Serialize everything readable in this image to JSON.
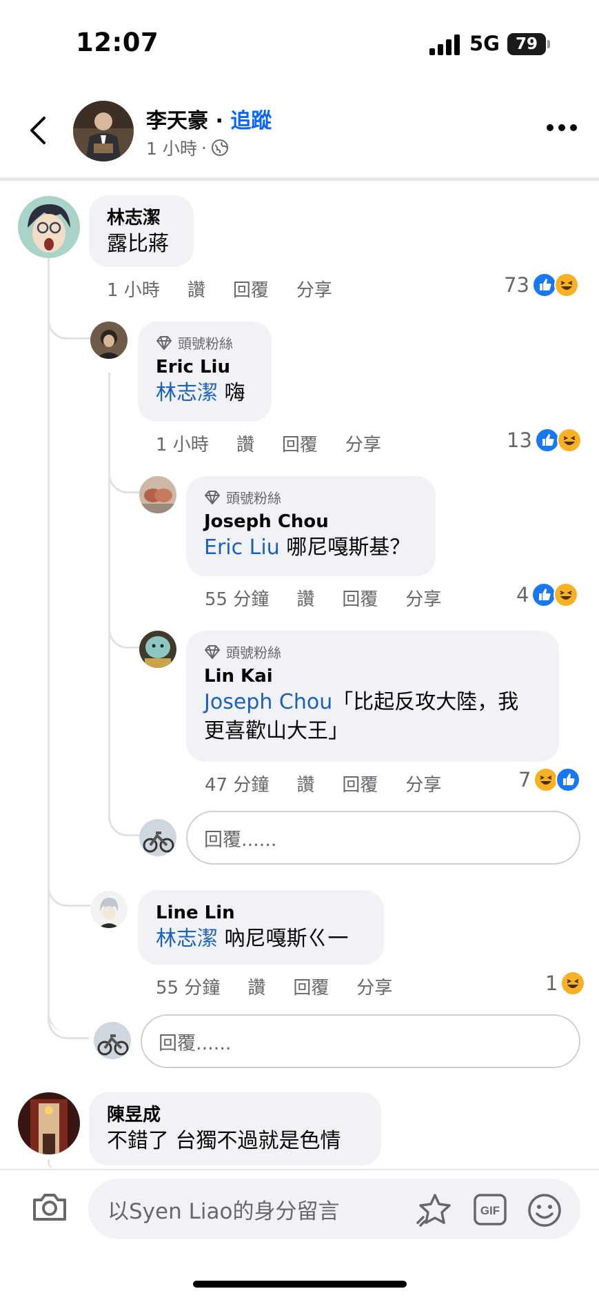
{
  "status_bar": {
    "time": "12:07",
    "network": "5G",
    "battery": "79"
  },
  "header": {
    "name": "李天豪",
    "separator": "·",
    "follow": "追蹤",
    "time": "1 小時",
    "dot": "·"
  },
  "comments": [
    {
      "name": "林志潔",
      "text": "露比蔣",
      "time": "1 小時",
      "like": "讚",
      "reply": "回覆",
      "share": "分享",
      "reactions": "73"
    },
    {
      "badge": "頭號粉絲",
      "name": "Eric Liu",
      "mention": "林志潔",
      "text": " 嗨",
      "time": "1 小時",
      "like": "讚",
      "reply": "回覆",
      "share": "分享",
      "reactions": "13"
    },
    {
      "badge": "頭號粉絲",
      "name": "Joseph Chou",
      "mention": "Eric Liu",
      "text": " 哪尼嘎斯基？",
      "time": "55 分鐘",
      "like": "讚",
      "reply": "回覆",
      "share": "分享",
      "reactions": "4"
    },
    {
      "badge": "頭號粉絲",
      "name": "Lin Kai",
      "mention": "Joseph Chou",
      "text_line1": "「比起反攻大陸，我",
      "text_line2": "更喜歡山大王」",
      "time": "47 分鐘",
      "like": "讚",
      "reply": "回覆",
      "share": "分享",
      "reactions": "7"
    },
    {
      "name": "Line Lin",
      "mention": "林志潔",
      "text": " 吶尼嘎斯ㄍ一",
      "time": "55 分鐘",
      "like": "讚",
      "reply": "回覆",
      "share": "分享",
      "reactions": "1"
    },
    {
      "name": "陳昱成",
      "text": "不錯了 台獨不過就是色情"
    }
  ],
  "reply_placeholder": "回覆......",
  "composer": {
    "placeholder": "以Syen Liao的身分留言",
    "gif": "GIF"
  },
  "icons": {
    "like": "like-reaction-icon",
    "haha": "haha-reaction-icon",
    "badge": "diamond-icon"
  },
  "colors": {
    "link": "#1b5fbf",
    "bubble": "#f0f2f5",
    "like": "#1877f2",
    "haha": "#f7b125"
  }
}
